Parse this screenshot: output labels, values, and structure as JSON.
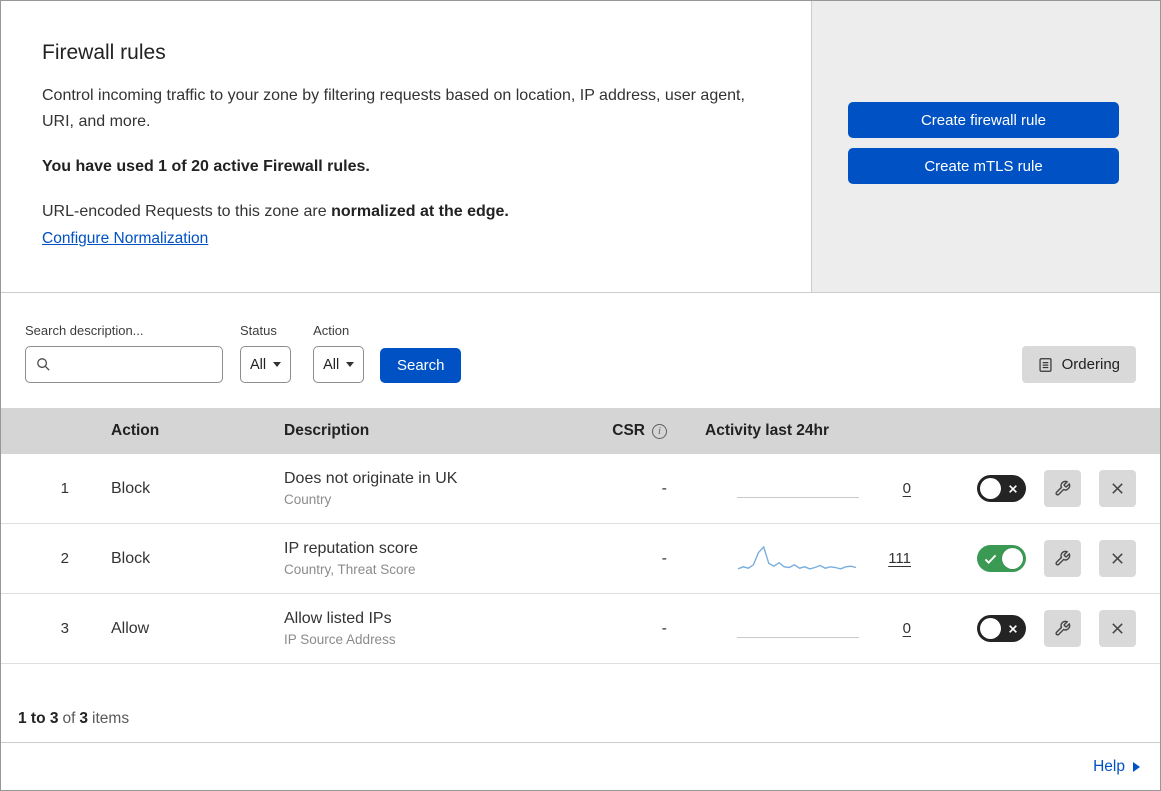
{
  "header": {
    "title": "Firewall rules",
    "description": "Control incoming traffic to your zone by filtering requests based on location, IP address, user agent, URI, and more.",
    "usage": "You have used 1 of 20 active Firewall rules.",
    "normalization_prefix": "URL-encoded Requests to this zone are ",
    "normalization_bold": "normalized at the edge.",
    "normalization_link": "Configure Normalization"
  },
  "buttons": {
    "create_firewall": "Create firewall rule",
    "create_mtls": "Create mTLS rule"
  },
  "filters": {
    "search_label": "Search description...",
    "status_label": "Status",
    "status_value": "All",
    "action_label": "Action",
    "action_value": "All",
    "search_button": "Search",
    "ordering": "Ordering"
  },
  "table": {
    "headers": {
      "action": "Action",
      "description": "Description",
      "csr": "CSR",
      "activity": "Activity last 24hr"
    },
    "rows": [
      {
        "priority": "1",
        "action": "Block",
        "description": "Does not originate in UK",
        "criteria": "Country",
        "csr": "-",
        "activity": "0",
        "enabled": false
      },
      {
        "priority": "2",
        "action": "Block",
        "description": "IP reputation score",
        "criteria": "Country, Threat Score",
        "csr": "-",
        "activity": "111",
        "enabled": true,
        "sparkline": [
          6,
          9,
          7,
          12,
          30,
          38,
          14,
          10,
          15,
          9,
          8,
          12,
          7,
          9,
          6,
          8,
          11,
          7,
          9,
          8,
          6,
          9,
          10,
          8
        ]
      },
      {
        "priority": "3",
        "action": "Allow",
        "description": "Allow listed IPs",
        "criteria": "IP Source Address",
        "csr": "-",
        "activity": "0",
        "enabled": false
      }
    ]
  },
  "footer": {
    "range": "1 to 3",
    "of": "of",
    "total": "3",
    "items": "items",
    "help": "Help"
  },
  "colors": {
    "primary_blue": "#0051c3",
    "toggle_on": "#3a9a54",
    "toggle_off": "#242424",
    "sparkline": "#7aaede",
    "table_header_bg": "#d5d5d5",
    "panel_bg": "#ededed",
    "control_bg": "#d9d9d9"
  }
}
